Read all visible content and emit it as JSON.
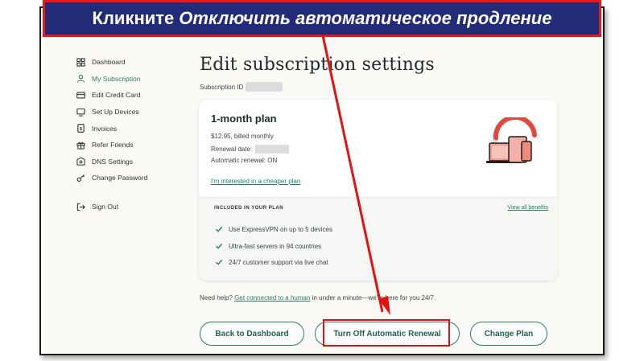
{
  "banner": {
    "prefix": "Кликните",
    "emphasis": "Отключить автоматическое продление"
  },
  "sidebar": {
    "items": [
      {
        "label": "Dashboard",
        "icon": "grid-icon"
      },
      {
        "label": "My Subscription",
        "icon": "user-icon",
        "active": true
      },
      {
        "label": "Edit Credit Card",
        "icon": "credit-card-icon"
      },
      {
        "label": "Set Up Devices",
        "icon": "devices-icon"
      },
      {
        "label": "Invoices",
        "icon": "invoice-icon"
      },
      {
        "label": "Refer Friends",
        "icon": "gift-icon"
      },
      {
        "label": "DNS Settings",
        "icon": "dns-icon"
      },
      {
        "label": "Change Password",
        "icon": "key-icon"
      }
    ],
    "sign_out": {
      "label": "Sign Out",
      "icon": "sign-out-icon"
    }
  },
  "main": {
    "title": "Edit subscription settings",
    "subscription_id_label": "Subscription ID"
  },
  "plan": {
    "name": "1-month plan",
    "price": "$12.95, billed monthly",
    "renewal_date_label": "Renewal date:",
    "auto_renewal": "Automatic renewal: ON",
    "cheaper_link": "I'm interested in a cheaper plan"
  },
  "benefits": {
    "heading": "INCLUDED IN YOUR PLAN",
    "view_all": "View all benefits",
    "items": [
      "Use ExpressVPN on up to 5 devices",
      "Ultra-fast servers in 94 countries",
      "24/7 customer support via live chat"
    ]
  },
  "help": {
    "prefix": "Need help?",
    "link": "Get connected to a human",
    "suffix": "in under a minute—we're here for you 24/7."
  },
  "buttons": {
    "back": "Back to Dashboard",
    "turn_off": "Turn Off Automatic Renewal",
    "change": "Change Plan"
  },
  "colors": {
    "accent": "#2a7a68",
    "banner_bg": "#222b78",
    "highlight": "#e11212"
  }
}
